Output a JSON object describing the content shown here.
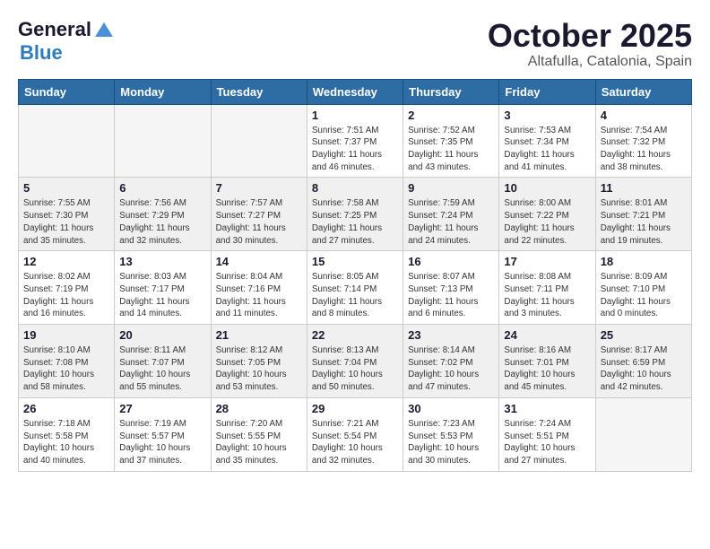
{
  "header": {
    "logo_line1": "General",
    "logo_line2": "Blue",
    "month": "October 2025",
    "location": "Altafulla, Catalonia, Spain"
  },
  "days_of_week": [
    "Sunday",
    "Monday",
    "Tuesday",
    "Wednesday",
    "Thursday",
    "Friday",
    "Saturday"
  ],
  "weeks": [
    {
      "shaded": false,
      "days": [
        {
          "num": "",
          "info": ""
        },
        {
          "num": "",
          "info": ""
        },
        {
          "num": "",
          "info": ""
        },
        {
          "num": "1",
          "info": "Sunrise: 7:51 AM\nSunset: 7:37 PM\nDaylight: 11 hours\nand 46 minutes."
        },
        {
          "num": "2",
          "info": "Sunrise: 7:52 AM\nSunset: 7:35 PM\nDaylight: 11 hours\nand 43 minutes."
        },
        {
          "num": "3",
          "info": "Sunrise: 7:53 AM\nSunset: 7:34 PM\nDaylight: 11 hours\nand 41 minutes."
        },
        {
          "num": "4",
          "info": "Sunrise: 7:54 AM\nSunset: 7:32 PM\nDaylight: 11 hours\nand 38 minutes."
        }
      ]
    },
    {
      "shaded": true,
      "days": [
        {
          "num": "5",
          "info": "Sunrise: 7:55 AM\nSunset: 7:30 PM\nDaylight: 11 hours\nand 35 minutes."
        },
        {
          "num": "6",
          "info": "Sunrise: 7:56 AM\nSunset: 7:29 PM\nDaylight: 11 hours\nand 32 minutes."
        },
        {
          "num": "7",
          "info": "Sunrise: 7:57 AM\nSunset: 7:27 PM\nDaylight: 11 hours\nand 30 minutes."
        },
        {
          "num": "8",
          "info": "Sunrise: 7:58 AM\nSunset: 7:25 PM\nDaylight: 11 hours\nand 27 minutes."
        },
        {
          "num": "9",
          "info": "Sunrise: 7:59 AM\nSunset: 7:24 PM\nDaylight: 11 hours\nand 24 minutes."
        },
        {
          "num": "10",
          "info": "Sunrise: 8:00 AM\nSunset: 7:22 PM\nDaylight: 11 hours\nand 22 minutes."
        },
        {
          "num": "11",
          "info": "Sunrise: 8:01 AM\nSunset: 7:21 PM\nDaylight: 11 hours\nand 19 minutes."
        }
      ]
    },
    {
      "shaded": false,
      "days": [
        {
          "num": "12",
          "info": "Sunrise: 8:02 AM\nSunset: 7:19 PM\nDaylight: 11 hours\nand 16 minutes."
        },
        {
          "num": "13",
          "info": "Sunrise: 8:03 AM\nSunset: 7:17 PM\nDaylight: 11 hours\nand 14 minutes."
        },
        {
          "num": "14",
          "info": "Sunrise: 8:04 AM\nSunset: 7:16 PM\nDaylight: 11 hours\nand 11 minutes."
        },
        {
          "num": "15",
          "info": "Sunrise: 8:05 AM\nSunset: 7:14 PM\nDaylight: 11 hours\nand 8 minutes."
        },
        {
          "num": "16",
          "info": "Sunrise: 8:07 AM\nSunset: 7:13 PM\nDaylight: 11 hours\nand 6 minutes."
        },
        {
          "num": "17",
          "info": "Sunrise: 8:08 AM\nSunset: 7:11 PM\nDaylight: 11 hours\nand 3 minutes."
        },
        {
          "num": "18",
          "info": "Sunrise: 8:09 AM\nSunset: 7:10 PM\nDaylight: 11 hours\nand 0 minutes."
        }
      ]
    },
    {
      "shaded": true,
      "days": [
        {
          "num": "19",
          "info": "Sunrise: 8:10 AM\nSunset: 7:08 PM\nDaylight: 10 hours\nand 58 minutes."
        },
        {
          "num": "20",
          "info": "Sunrise: 8:11 AM\nSunset: 7:07 PM\nDaylight: 10 hours\nand 55 minutes."
        },
        {
          "num": "21",
          "info": "Sunrise: 8:12 AM\nSunset: 7:05 PM\nDaylight: 10 hours\nand 53 minutes."
        },
        {
          "num": "22",
          "info": "Sunrise: 8:13 AM\nSunset: 7:04 PM\nDaylight: 10 hours\nand 50 minutes."
        },
        {
          "num": "23",
          "info": "Sunrise: 8:14 AM\nSunset: 7:02 PM\nDaylight: 10 hours\nand 47 minutes."
        },
        {
          "num": "24",
          "info": "Sunrise: 8:16 AM\nSunset: 7:01 PM\nDaylight: 10 hours\nand 45 minutes."
        },
        {
          "num": "25",
          "info": "Sunrise: 8:17 AM\nSunset: 6:59 PM\nDaylight: 10 hours\nand 42 minutes."
        }
      ]
    },
    {
      "shaded": false,
      "days": [
        {
          "num": "26",
          "info": "Sunrise: 7:18 AM\nSunset: 5:58 PM\nDaylight: 10 hours\nand 40 minutes."
        },
        {
          "num": "27",
          "info": "Sunrise: 7:19 AM\nSunset: 5:57 PM\nDaylight: 10 hours\nand 37 minutes."
        },
        {
          "num": "28",
          "info": "Sunrise: 7:20 AM\nSunset: 5:55 PM\nDaylight: 10 hours\nand 35 minutes."
        },
        {
          "num": "29",
          "info": "Sunrise: 7:21 AM\nSunset: 5:54 PM\nDaylight: 10 hours\nand 32 minutes."
        },
        {
          "num": "30",
          "info": "Sunrise: 7:23 AM\nSunset: 5:53 PM\nDaylight: 10 hours\nand 30 minutes."
        },
        {
          "num": "31",
          "info": "Sunrise: 7:24 AM\nSunset: 5:51 PM\nDaylight: 10 hours\nand 27 minutes."
        },
        {
          "num": "",
          "info": ""
        }
      ]
    }
  ]
}
